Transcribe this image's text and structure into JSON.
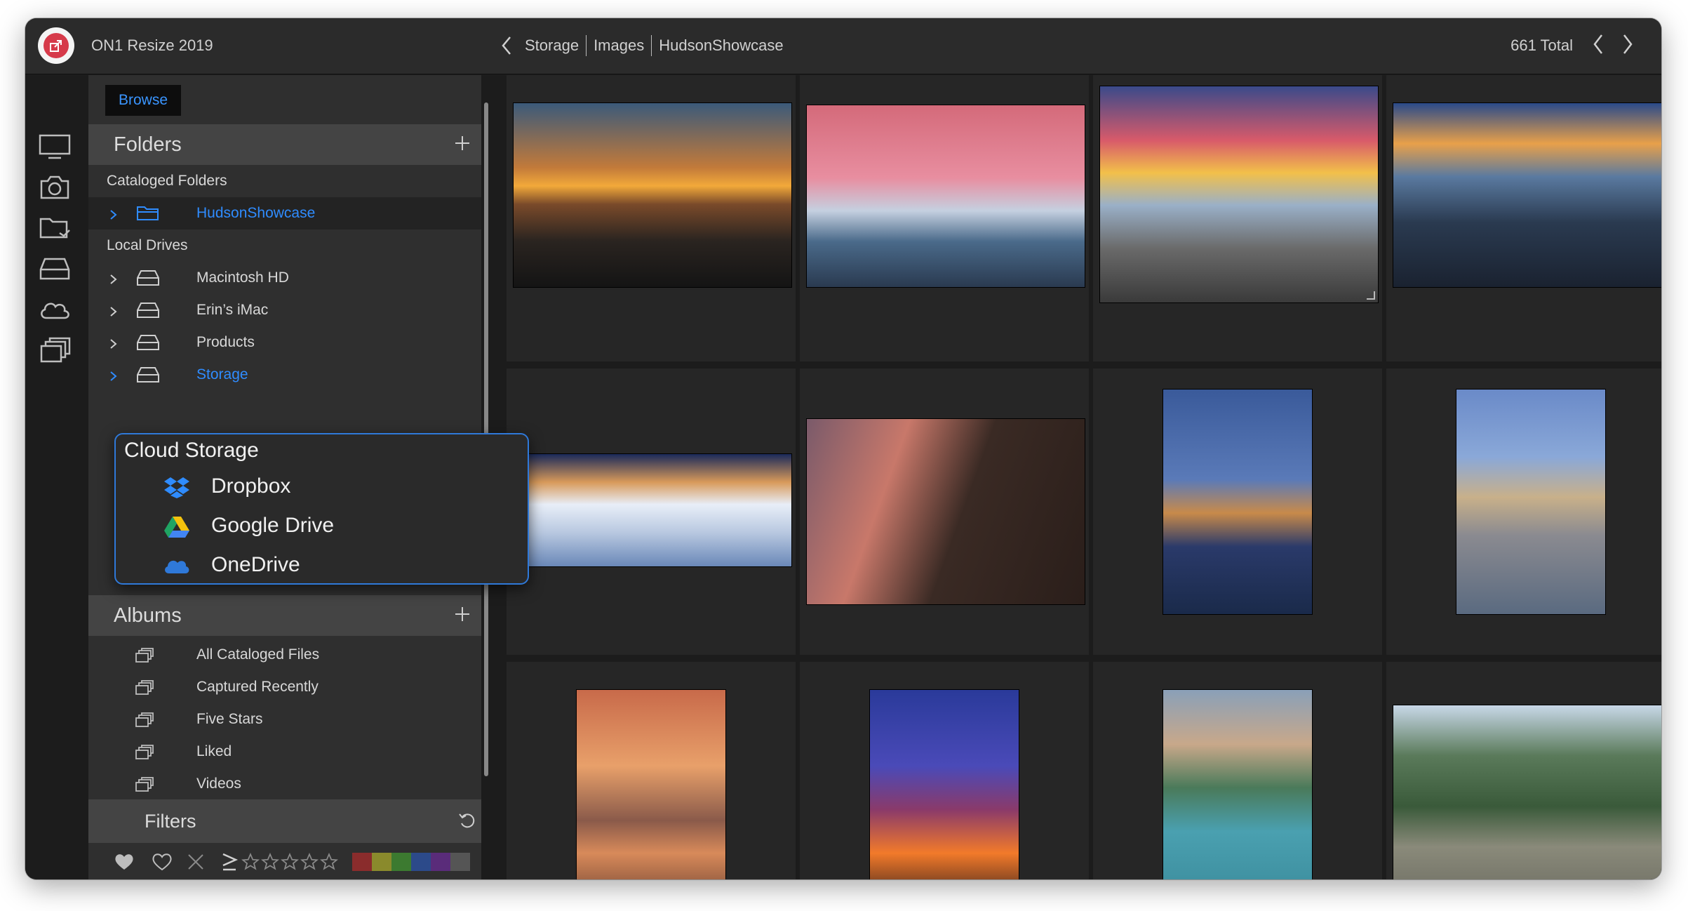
{
  "window": {
    "app_title": "ON1 Resize 2019",
    "breadcrumb": [
      "Storage",
      "Images",
      "HudsonShowcase"
    ],
    "total": "661 Total"
  },
  "rail": {
    "icons": [
      "monitor-icon",
      "camera-icon",
      "folder-icon",
      "drive-icon",
      "cloud-icon",
      "albums-icon"
    ]
  },
  "panel": {
    "browse_label": "Browse",
    "folders": {
      "title": "Folders",
      "cataloged_label": "Cataloged Folders",
      "cataloged": [
        {
          "label": "HudsonShowcase",
          "selected": true
        }
      ],
      "local_label": "Local Drives",
      "drives": [
        {
          "label": "Macintosh HD"
        },
        {
          "label": "Erin’s iMac"
        },
        {
          "label": "Products"
        },
        {
          "label": "Storage",
          "active": true
        }
      ]
    },
    "cloud": {
      "title": "Cloud Storage",
      "items": [
        {
          "label": "Dropbox",
          "icon": "dropbox-icon"
        },
        {
          "label": "Google Drive",
          "icon": "google-drive-icon"
        },
        {
          "label": "OneDrive",
          "icon": "onedrive-icon"
        }
      ]
    },
    "albums": {
      "title": "Albums",
      "items": [
        {
          "label": "All Cataloged Files"
        },
        {
          "label": "Captured Recently"
        },
        {
          "label": "Five Stars"
        },
        {
          "label": "Liked"
        },
        {
          "label": "Videos"
        }
      ]
    },
    "filters": {
      "title": "Filters",
      "color_labels": [
        "#8a2c2c",
        "#8a8a2c",
        "#3c7a30",
        "#2c4a8a",
        "#5a2c7a",
        "#555555"
      ]
    }
  },
  "colors": {
    "accent": "#2f8cff",
    "highlight_border": "#2f79d9"
  },
  "grid": {
    "thumbnails": [
      "sunset-rocky-coast",
      "pink-sky-mount-hood",
      "sunset-seascape-rocks",
      "blue-hour-tide-pools",
      "snowy-mountain-ridge",
      "photographer-with-camera",
      "mosque-night-reflection",
      "blue-mosque-courtyard",
      "sailboats-sunset",
      "volcano-eruption",
      "beach-crowd-positano",
      "woman-on-stone-wall"
    ]
  }
}
